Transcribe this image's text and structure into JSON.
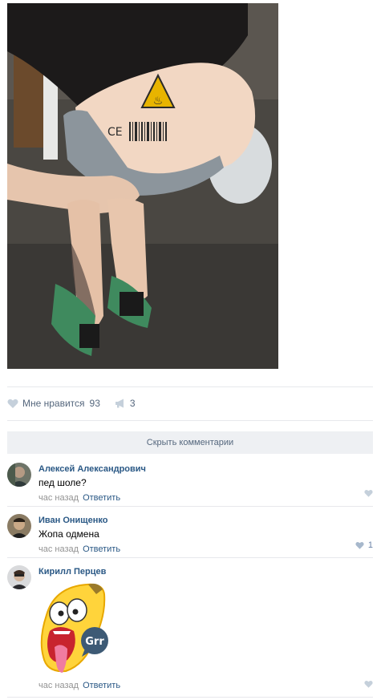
{
  "post": {
    "likes_label": "Мне нравится",
    "likes_count": "93",
    "shares_count": "3",
    "hide_comments_label": "Скрыть комментарии"
  },
  "comments": [
    {
      "author": "Алексей Александрович",
      "text": "пед шоле?",
      "time": "час назад",
      "reply_label": "Ответить",
      "likes": ""
    },
    {
      "author": "Иван Онищенко",
      "text": "Жопа одмена",
      "time": "час назад",
      "reply_label": "Ответить",
      "likes": "1"
    },
    {
      "author": "Кирилл Перцев",
      "sticker_text": "Grr",
      "time": "час назад",
      "reply_label": "Ответить",
      "likes": ""
    }
  ],
  "icons": {
    "like": "heart-icon",
    "share": "megaphone-icon"
  },
  "colors": {
    "link": "#2a5885",
    "action": "#55677d",
    "meta": "#939393",
    "icon": "#6a83a7"
  }
}
